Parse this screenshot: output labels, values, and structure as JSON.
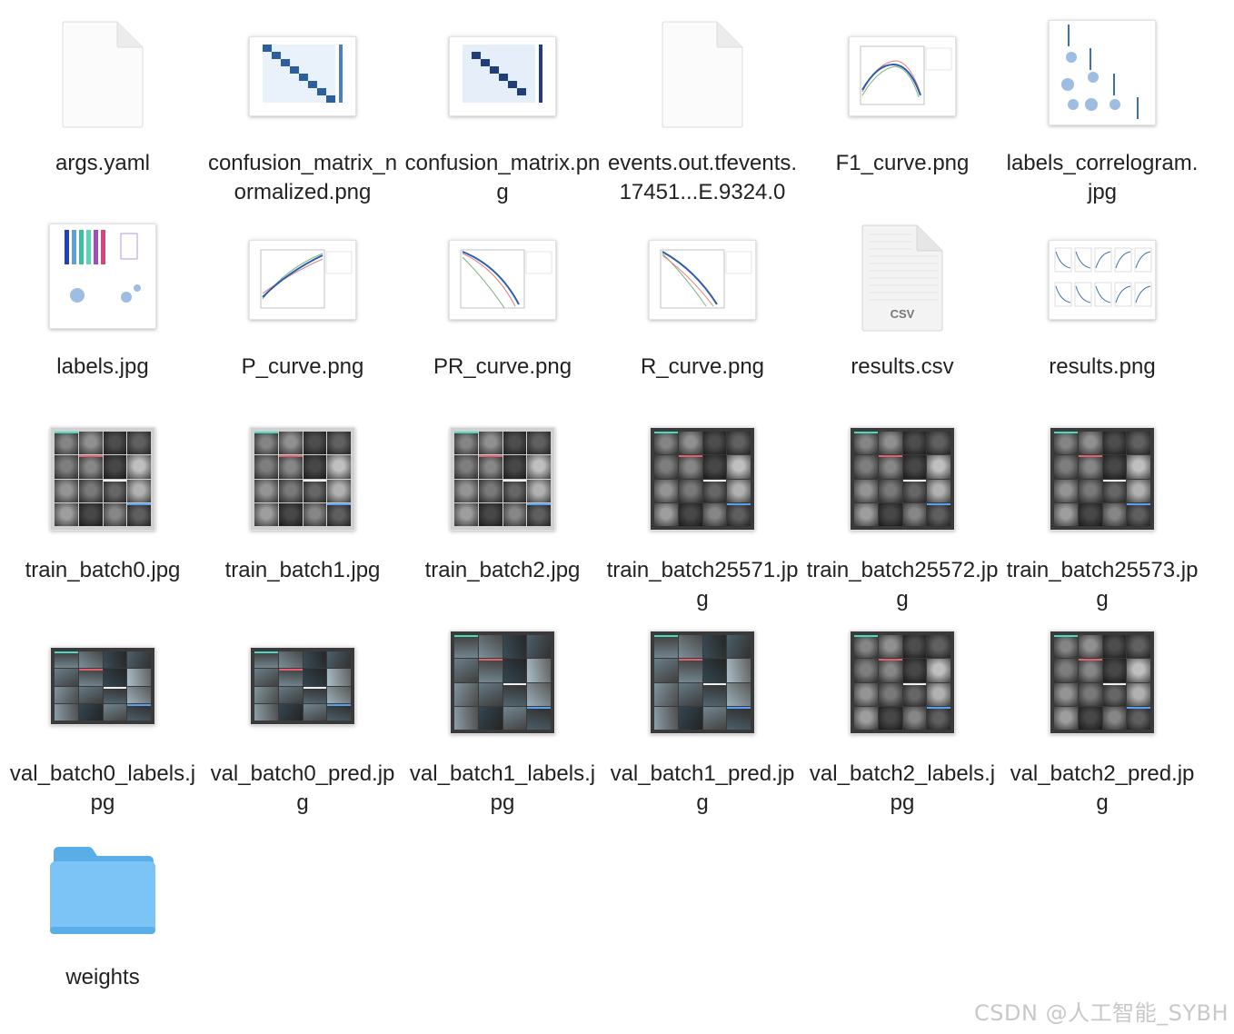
{
  "files": [
    {
      "name": "args.yaml",
      "kind": "doc"
    },
    {
      "name": "confusion_matrix_normalized.png",
      "kind": "matrix"
    },
    {
      "name": "confusion_matrix.png",
      "kind": "matrix"
    },
    {
      "name": "events.out.tfevents.17451...E.9324.0",
      "kind": "doc"
    },
    {
      "name": "F1_curve.png",
      "kind": "curve"
    },
    {
      "name": "labels_correlogram.jpg",
      "kind": "correlogram"
    },
    {
      "name": "labels.jpg",
      "kind": "labels"
    },
    {
      "name": "P_curve.png",
      "kind": "curve"
    },
    {
      "name": "PR_curve.png",
      "kind": "curve"
    },
    {
      "name": "R_curve.png",
      "kind": "curve"
    },
    {
      "name": "results.csv",
      "kind": "csv",
      "badge": "CSV"
    },
    {
      "name": "results.png",
      "kind": "results"
    },
    {
      "name": "train_batch0.jpg",
      "kind": "faces"
    },
    {
      "name": "train_batch1.jpg",
      "kind": "faces"
    },
    {
      "name": "train_batch2.jpg",
      "kind": "faces"
    },
    {
      "name": "train_batch25571.jpg",
      "kind": "faces-dark"
    },
    {
      "name": "train_batch25572.jpg",
      "kind": "faces-dark"
    },
    {
      "name": "train_batch25573.jpg",
      "kind": "faces-dark"
    },
    {
      "name": "val_batch0_labels.jpg",
      "kind": "val-wide"
    },
    {
      "name": "val_batch0_pred.jpg",
      "kind": "val-wide"
    },
    {
      "name": "val_batch1_labels.jpg",
      "kind": "val-grid"
    },
    {
      "name": "val_batch1_pred.jpg",
      "kind": "val-grid"
    },
    {
      "name": "val_batch2_labels.jpg",
      "kind": "faces-dark"
    },
    {
      "name": "val_batch2_pred.jpg",
      "kind": "faces-dark"
    },
    {
      "name": "weights",
      "kind": "folder"
    }
  ],
  "watermark": "CSDN @人工智能_SYBH",
  "colors": {
    "folder": "#7cc4f5",
    "folder_tab": "#5aaee8",
    "chart_blue": "#2a5db0"
  }
}
